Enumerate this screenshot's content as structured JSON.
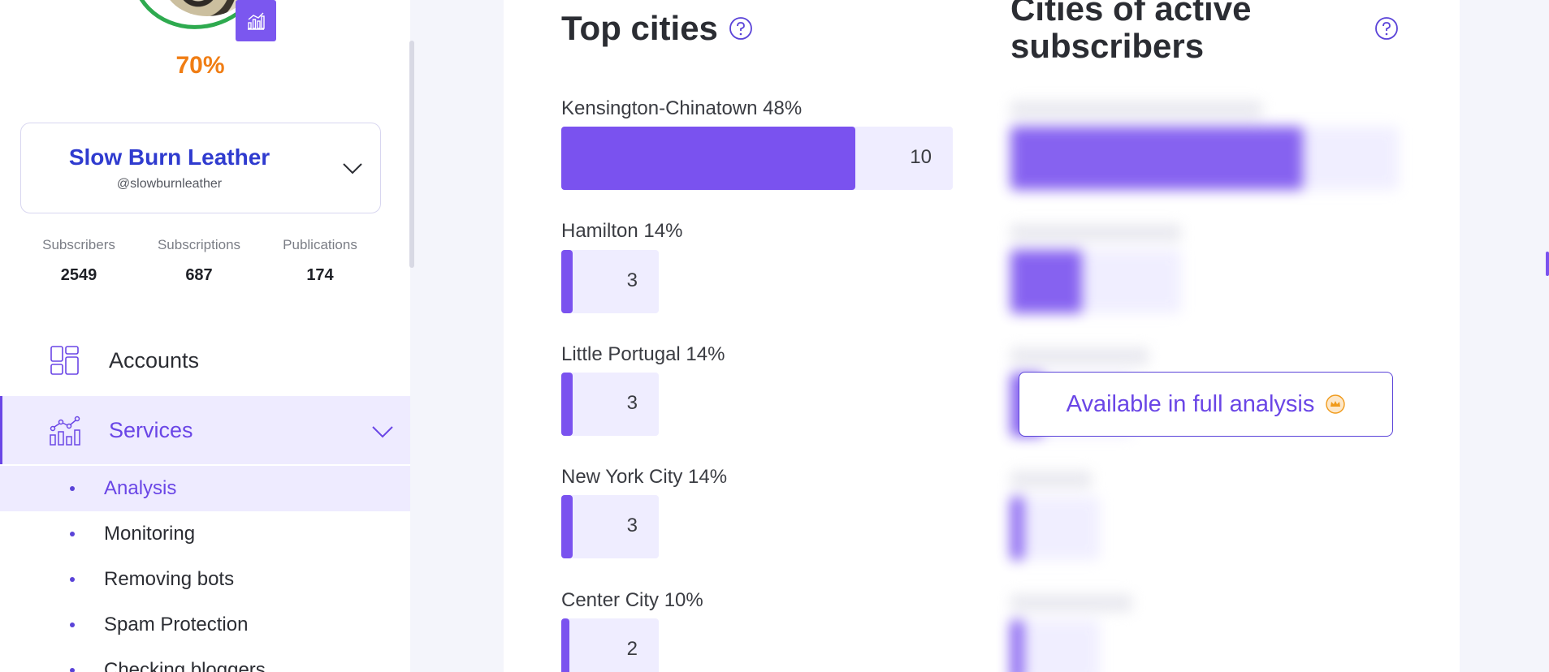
{
  "profile": {
    "percent": "70%",
    "name": "Slow Burn Leather",
    "handle": "@slowburnleather",
    "ring_color": "#2eaa4f",
    "percent_color": "#f07d14"
  },
  "stats": [
    {
      "label": "Subscribers",
      "value": "2549"
    },
    {
      "label": "Subscriptions",
      "value": "687"
    },
    {
      "label": "Publications",
      "value": "174"
    }
  ],
  "nav": {
    "accounts_label": "Accounts",
    "services_label": "Services",
    "services_items": [
      {
        "label": "Analysis",
        "active": true
      },
      {
        "label": "Monitoring",
        "active": false
      },
      {
        "label": "Removing bots",
        "active": false
      },
      {
        "label": "Spam Protection",
        "active": false
      },
      {
        "label": "Checking bloggers",
        "active": false
      }
    ]
  },
  "top_cities": {
    "title": "Top cities",
    "items": [
      {
        "label": "Kensington-Chinatown 48%",
        "value": "10",
        "count": 10
      },
      {
        "label": "Hamilton 14%",
        "value": "3",
        "count": 3
      },
      {
        "label": "Little Portugal 14%",
        "value": "3",
        "count": 3
      },
      {
        "label": "New York City 14%",
        "value": "3",
        "count": 3
      },
      {
        "label": "Center City 10%",
        "value": "2",
        "count": 2
      }
    ]
  },
  "active_cities": {
    "title_line1": "Cities of active",
    "title_line2": "subscribers",
    "cta_label": "Available in full analysis"
  },
  "colors": {
    "accent": "#6a46e6",
    "bar_fill": "#7a52ef",
    "bar_track": "#efedff",
    "brand_name": "#2f3bcf"
  }
}
